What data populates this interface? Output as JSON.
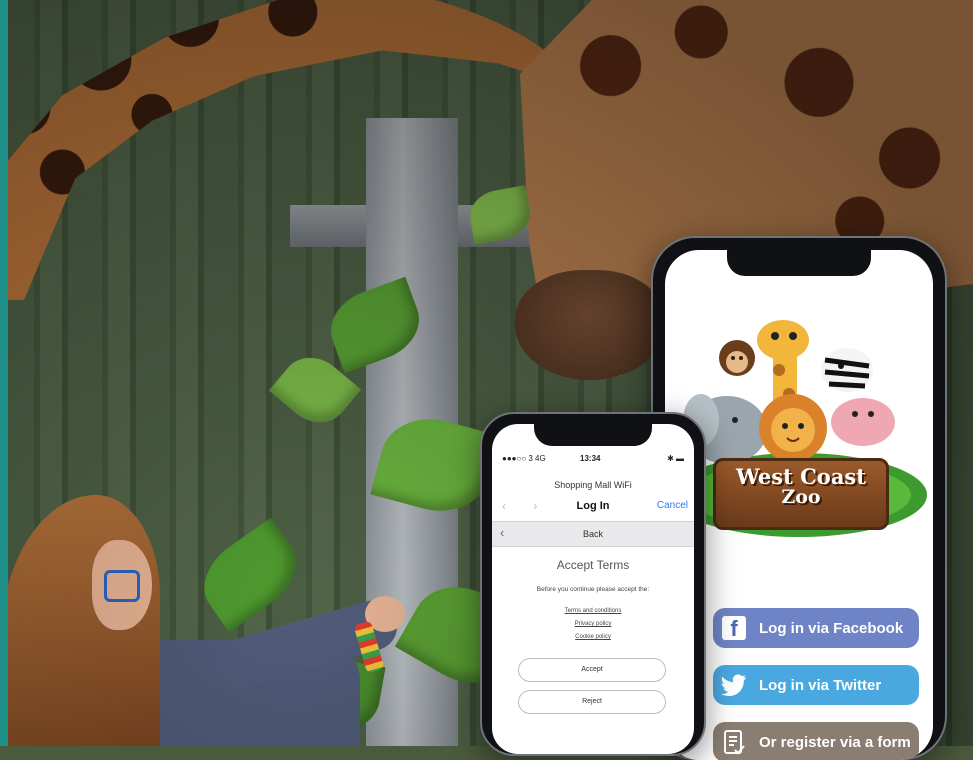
{
  "small_phone": {
    "status": {
      "signal": "●●●○○ 3  4G",
      "time": "13:34",
      "battery": "✱ ▬"
    },
    "network_name": "Shopping Mall WiFi",
    "nav": {
      "title": "Log In",
      "cancel": "Cancel"
    },
    "back_label": "Back",
    "heading": "Accept Terms",
    "intro": "Before you continue please accept the:",
    "links": [
      "Terms and conditions",
      "Privacy policy",
      "Cookie policy"
    ],
    "accept_label": "Accept",
    "reject_label": "Reject",
    "colors": {
      "link": "#2f7be8",
      "background": "#ffffff"
    }
  },
  "big_phone": {
    "logo": {
      "line1": "West Coast",
      "line2": "Zoo"
    },
    "buttons": {
      "facebook": "Log in via Facebook",
      "twitter": "Log in via Twitter",
      "register": "Or register via a form"
    },
    "colors": {
      "facebook": "#6f84c6",
      "twitter": "#4aa8e0",
      "register": "#8a7d72"
    }
  },
  "icons": [
    "facebook-icon",
    "twitter-icon",
    "form-icon",
    "chevron-left-icon"
  ]
}
